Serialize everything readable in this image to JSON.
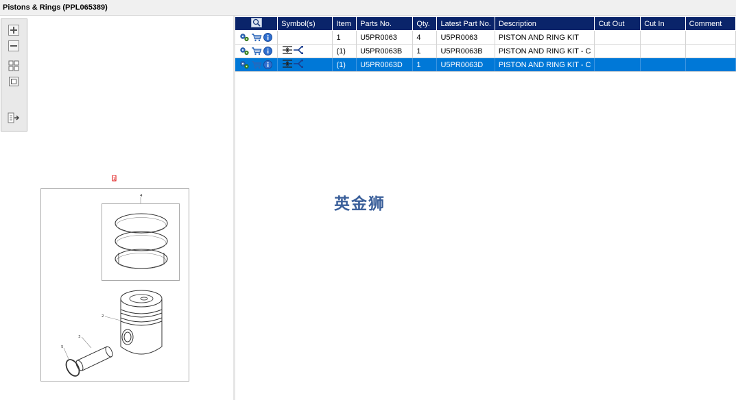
{
  "window": {
    "title": "Pistons & Rings (PPL065389)"
  },
  "toolbar": {
    "buttons": [
      {
        "name": "zoom-in-button",
        "icon": "plus-icon"
      },
      {
        "name": "zoom-out-button",
        "icon": "minus-icon"
      },
      {
        "name": "fit-all-button",
        "icon": "grid-icon"
      },
      {
        "name": "fit-window-button",
        "icon": "square-icon"
      },
      {
        "name": "export-button",
        "icon": "export-icon"
      }
    ]
  },
  "diagram": {
    "marker": "1",
    "callouts": [
      "4",
      "2",
      "3",
      "5"
    ]
  },
  "grid": {
    "headers": {
      "search": "",
      "symbols": "Symbol(s)",
      "item": "Item",
      "parts_no": "Parts No.",
      "qty": "Qty.",
      "latest": "Latest Part No.",
      "description": "Description",
      "cut_out": "Cut Out",
      "cut_in": "Cut In",
      "comment": "Comment"
    },
    "rows": [
      {
        "item": "1",
        "parts_no": "U5PR0063",
        "qty": "4",
        "latest": "U5PR0063",
        "description": "PISTON AND RING KIT",
        "cut_out": "",
        "cut_in": "",
        "comment": "",
        "has_symbol": false,
        "selected": false
      },
      {
        "item": "(1)",
        "parts_no": "U5PR0063B",
        "qty": "1",
        "latest": "U5PR0063B",
        "description": "PISTON AND RING KIT - C",
        "cut_out": "",
        "cut_in": "",
        "comment": "",
        "has_symbol": true,
        "selected": false
      },
      {
        "item": "(1)",
        "parts_no": "U5PR0063D",
        "qty": "1",
        "latest": "U5PR0063D",
        "description": "PISTON AND RING KIT - C",
        "cut_out": "",
        "cut_in": "",
        "comment": "",
        "has_symbol": true,
        "selected": true
      }
    ]
  },
  "watermark": "英金狮",
  "colors": {
    "header": "#0a246a",
    "selected": "#0078d7"
  }
}
